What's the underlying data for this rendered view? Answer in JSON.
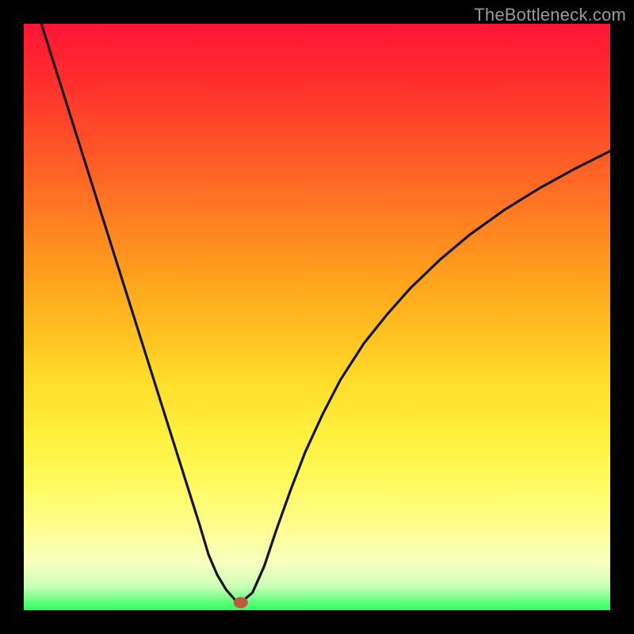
{
  "watermark": "TheBottleneck.com",
  "colors": {
    "page_bg": "#000000",
    "curve_stroke": "#141414",
    "marker_fill": "#bb5a3e",
    "watermark_text": "#9a9a9a"
  },
  "chart_data": {
    "type": "line",
    "title": "",
    "xlabel": "",
    "ylabel": "",
    "xlim": [
      0,
      100
    ],
    "ylim": [
      0,
      100
    ],
    "grid": false,
    "legend": false,
    "x": [
      3,
      6,
      9,
      12,
      15,
      18,
      21,
      24,
      27,
      30,
      31.5,
      33,
      34.5,
      36,
      37,
      39,
      41,
      43,
      45.5,
      48,
      51,
      54,
      58,
      62,
      66,
      71,
      76,
      82,
      88,
      94,
      100
    ],
    "values": [
      100,
      90.5,
      81,
      71.5,
      62,
      52.5,
      43,
      33.5,
      24,
      14.5,
      9.5,
      6,
      3.5,
      1.8,
      1.3,
      3.0,
      7.5,
      13.5,
      20.5,
      27.0,
      33.5,
      39.3,
      45.5,
      50.5,
      55.0,
      59.8,
      64.0,
      68.3,
      72.0,
      75.3,
      78.3
    ],
    "marker": {
      "x": 37,
      "y": 1.3
    },
    "notes": "Values are relative percentages read off the plot background; the y-axis is inverted visually (0 at bottom = green, 100 at top = red). The curve has a sharp minimum near x≈37 and rises asymptotically toward ~80 on the right."
  }
}
